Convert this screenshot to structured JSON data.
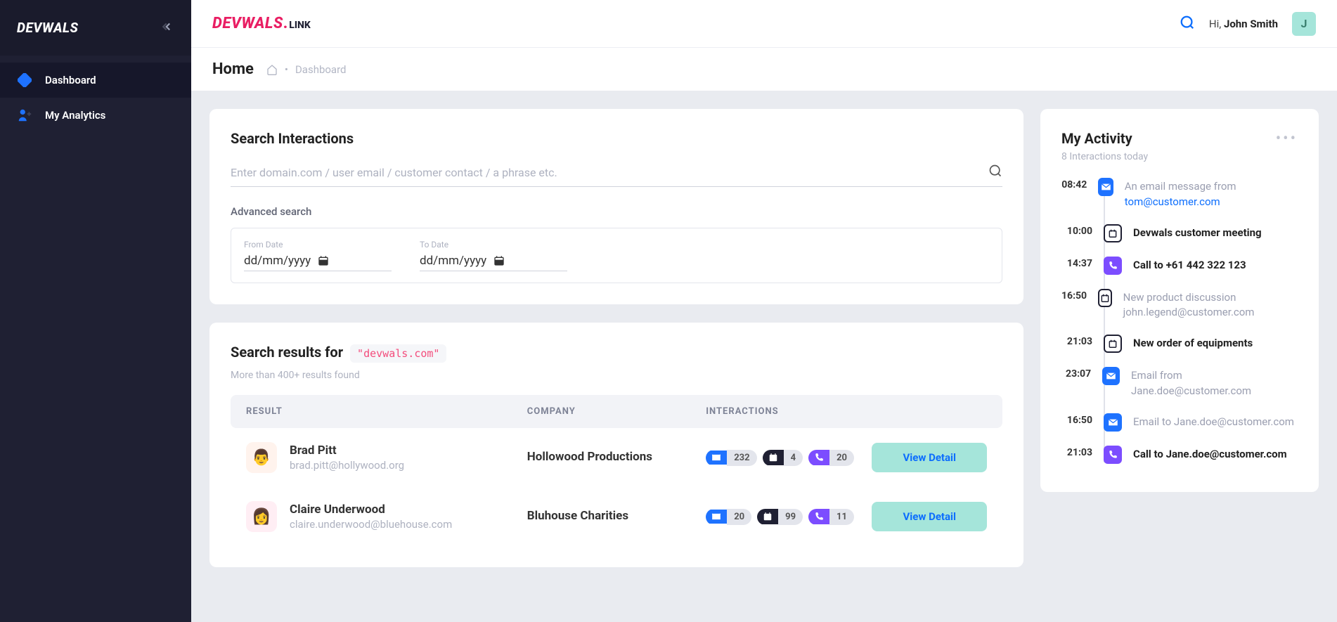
{
  "sidebar": {
    "logo": "DEVWALS",
    "items": [
      {
        "label": "Dashboard"
      },
      {
        "label": "My Analytics"
      }
    ]
  },
  "header": {
    "brand_main": "DEVWALS",
    "brand_sub": "LINK",
    "greeting_prefix": "Hi, ",
    "user_name": "John Smith",
    "avatar_initial": "J"
  },
  "breadcrumb": {
    "title": "Home",
    "current": "Dashboard"
  },
  "search": {
    "title": "Search Interactions",
    "placeholder": "Enter domain.com / user email / customer contact / a phrase etc.",
    "advanced_label": "Advanced search",
    "from_label": "From Date",
    "from_value": "dd/mm/yyyy",
    "to_label": "To Date",
    "to_value": "dd/mm/yyyy"
  },
  "results": {
    "title_prefix": "Search results for",
    "query": "\"devwals.com\"",
    "subtitle": "More than 400+ results found",
    "headers": {
      "result": "RESULT",
      "company": "COMPANY",
      "interactions": "INTERACTIONS"
    },
    "view_label": "View Detail",
    "rows": [
      {
        "name": "Brad Pitt",
        "email": "brad.pitt@hollywood.org",
        "avatar_emoji": "👨",
        "company": "Hollowood Productions",
        "counts": {
          "emails": "232",
          "meetings": "4",
          "calls": "20"
        }
      },
      {
        "name": "Claire Underwood",
        "email": "claire.underwood@bluehouse.com",
        "avatar_emoji": "👩",
        "company": "Bluhouse Charities",
        "counts": {
          "emails": "20",
          "meetings": "99",
          "calls": "11"
        }
      }
    ]
  },
  "activity": {
    "title": "My Activity",
    "subtitle": "8 Interactions today",
    "items": [
      {
        "time": "08:42",
        "type": "email",
        "muted": true,
        "text_prefix": "An email message from ",
        "link": "tom@customer.com"
      },
      {
        "time": "10:00",
        "type": "meeting",
        "muted": false,
        "text": "Devwals customer meeting"
      },
      {
        "time": "14:37",
        "type": "phone",
        "muted": false,
        "text": "Call to +61 442 322 123"
      },
      {
        "time": "16:50",
        "type": "meeting",
        "muted": true,
        "text": "New product discussion john.legend@customer.com"
      },
      {
        "time": "21:03",
        "type": "meeting",
        "muted": false,
        "text": "New order of equipments"
      },
      {
        "time": "23:07",
        "type": "email",
        "muted": true,
        "text": "Email from Jane.doe@customer.com"
      },
      {
        "time": "16:50",
        "type": "email",
        "muted": true,
        "text": "Email to Jane.doe@customer.com"
      },
      {
        "time": "21:03",
        "type": "phone",
        "muted": false,
        "text": "Call to Jane.doe@customer.com"
      }
    ]
  }
}
